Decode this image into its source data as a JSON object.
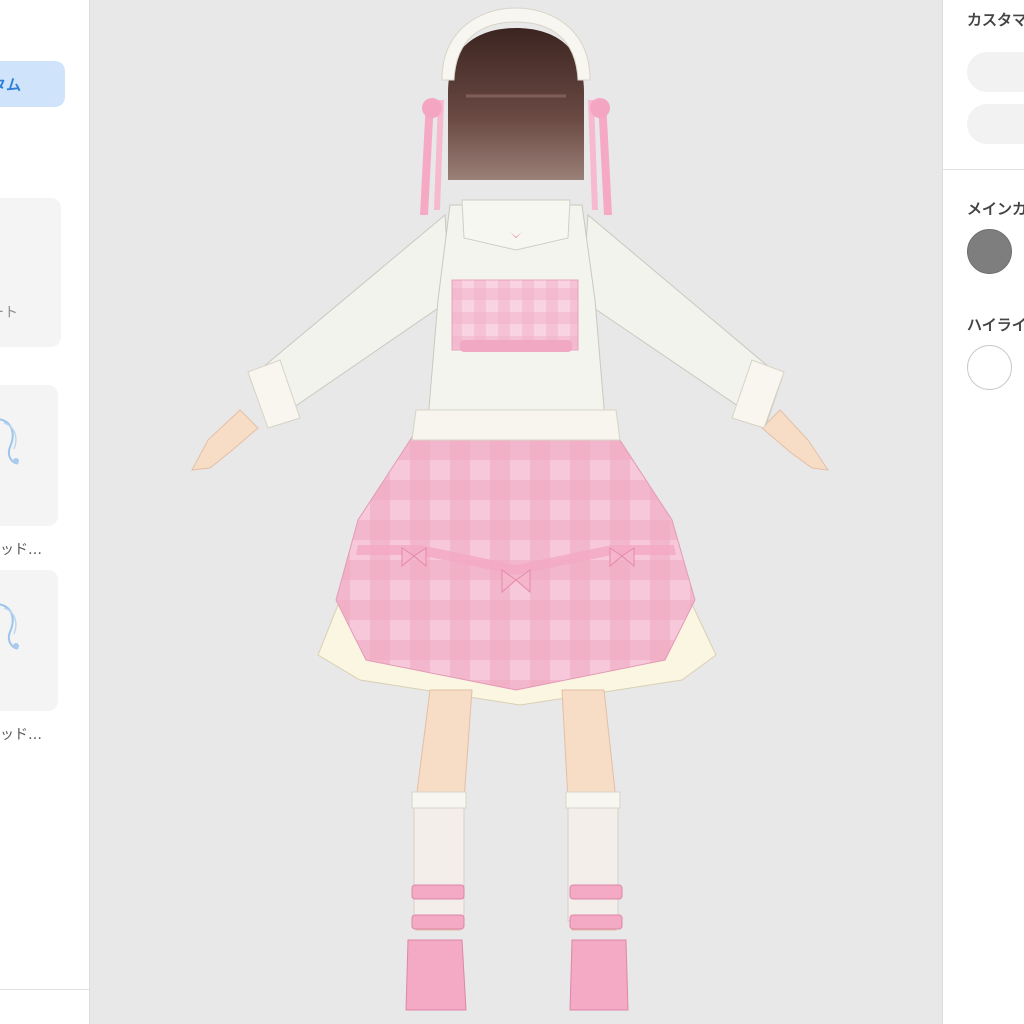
{
  "left_panel": {
    "active_tab_label": "タム",
    "items": [
      {
        "label": "ート"
      },
      {
        "label": "ッド…"
      },
      {
        "label": "ッド…"
      }
    ]
  },
  "right_panel": {
    "customize_title": "カスタマ",
    "main_color_title": "メインカ",
    "highlight_title": "ハイライ",
    "main_color": "#7e7e7e",
    "highlight_color": "#ffffff"
  },
  "viewport": {
    "background": "#e8e8e8"
  }
}
